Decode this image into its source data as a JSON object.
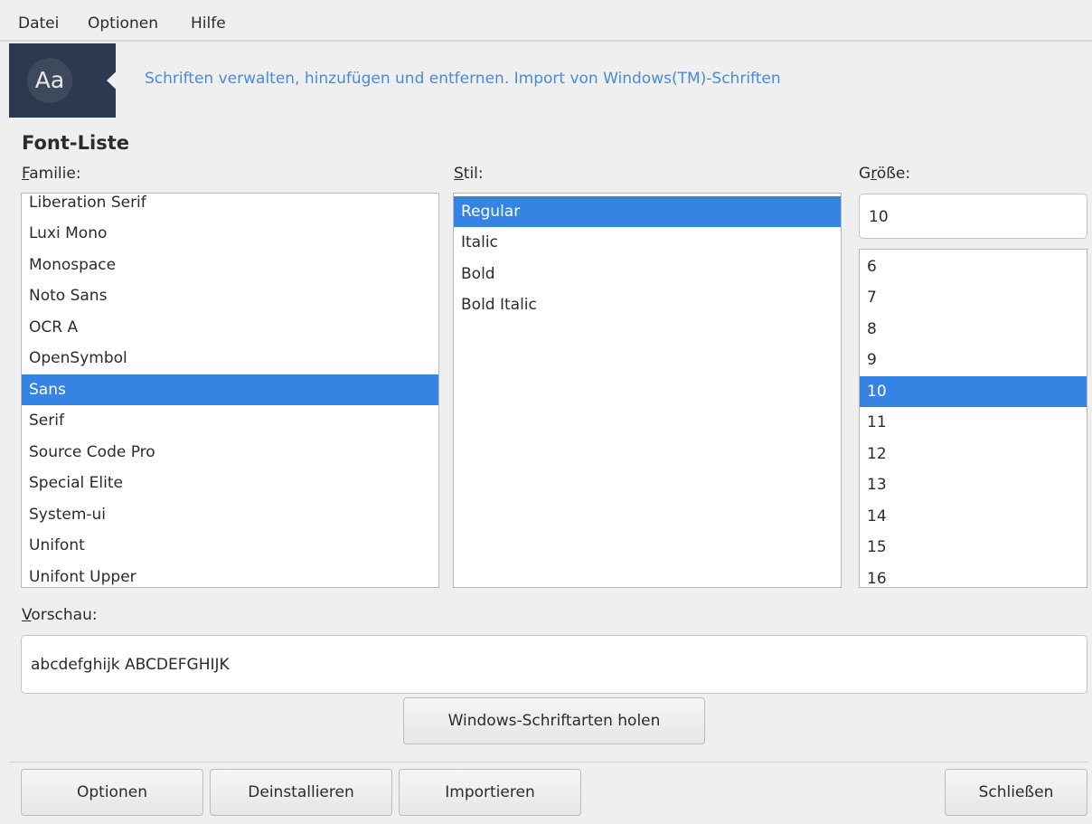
{
  "menubar": {
    "items": [
      "Datei",
      "Optionen",
      "Hilfe"
    ]
  },
  "banner": {
    "icon_text": "Aa",
    "text": "Schriften verwalten, hinzufügen und entfernen. Import von Windows(TM)-Schriften"
  },
  "section": {
    "title": "Font-Liste"
  },
  "family": {
    "label_mnemonic": "F",
    "label_rest": "amilie:",
    "items": [
      "Liberation Serif",
      "Luxi Mono",
      "Monospace",
      "Noto Sans",
      "OCR A",
      "OpenSymbol",
      "Sans",
      "Serif",
      "Source Code Pro",
      "Special Elite",
      "System-ui",
      "Unifont",
      "Unifont Upper"
    ],
    "selected": "Sans"
  },
  "style": {
    "label_mnemonic": "S",
    "label_rest": "til:",
    "items": [
      "Regular",
      "Italic",
      "Bold",
      "Bold Italic"
    ],
    "selected": "Regular"
  },
  "size": {
    "label_first": "G",
    "label_mnemonic": "r",
    "label_rest": "öße:",
    "value": "10",
    "items": [
      "6",
      "7",
      "8",
      "9",
      "10",
      "11",
      "12",
      "13",
      "14",
      "15",
      "16"
    ],
    "selected": "10"
  },
  "preview": {
    "label_mnemonic": "V",
    "label_rest": "orschau:",
    "text": "abcdefghijk ABCDEFGHIJK"
  },
  "buttons": {
    "windows_fonts": "Windows-Schriftarten holen",
    "options": "Optionen",
    "uninstall": "Deinstallieren",
    "import": "Importieren",
    "close": "Schließen"
  },
  "colors": {
    "selection": "#3584e4",
    "banner_bg": "#2c3a50",
    "banner_text": "#4a8ad8"
  }
}
